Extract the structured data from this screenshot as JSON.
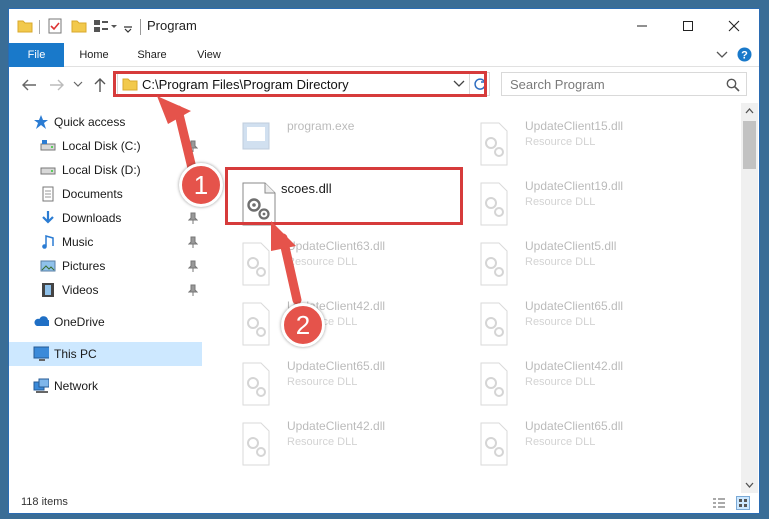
{
  "window": {
    "title": "Program"
  },
  "ribbon": {
    "tabs": [
      "File",
      "Home",
      "Share",
      "View"
    ]
  },
  "address_bar": {
    "path": "C:\\Program Files\\Program Directory"
  },
  "search": {
    "placeholder": "Search Program"
  },
  "sidebar": {
    "items": [
      {
        "label": "Quick access",
        "icon": "star-icon"
      },
      {
        "label": "Local Disk (C:)",
        "icon": "drive-icon",
        "pinned": true
      },
      {
        "label": "Local Disk (D:)",
        "icon": "drive-icon",
        "pinned": true
      },
      {
        "label": "Documents",
        "icon": "documents-icon",
        "pinned": true
      },
      {
        "label": "Downloads",
        "icon": "download-icon",
        "pinned": true
      },
      {
        "label": "Music",
        "icon": "music-icon",
        "pinned": true
      },
      {
        "label": "Pictures",
        "icon": "pictures-icon",
        "pinned": true
      },
      {
        "label": "Videos",
        "icon": "videos-icon",
        "pinned": true
      },
      {
        "label": "OneDrive",
        "icon": "cloud-icon"
      },
      {
        "label": "This PC",
        "icon": "computer-icon",
        "selected": true
      },
      {
        "label": "Network",
        "icon": "network-icon"
      }
    ]
  },
  "files": [
    {
      "name": "program.exe",
      "type": ""
    },
    {
      "name": "UpdateClient15.dll",
      "type": "Resource DLL"
    },
    {
      "name": "scoes.dll",
      "type": "",
      "highlighted": true
    },
    {
      "name": "UpdateClient19.dll",
      "type": "Resource DLL"
    },
    {
      "name": "UpdateClient63.dll",
      "type": "Resource DLL"
    },
    {
      "name": "UpdateClient5.dll",
      "type": "Resource DLL"
    },
    {
      "name": "UpdateClient42.dll",
      "type": "Resource DLL"
    },
    {
      "name": "UpdateClient65.dll",
      "type": "Resource DLL"
    },
    {
      "name": "UpdateClient65.dll",
      "type": "Resource DLL"
    },
    {
      "name": "UpdateClient42.dll",
      "type": "Resource DLL"
    },
    {
      "name": "UpdateClient42.dll",
      "type": "Resource DLL"
    },
    {
      "name": "UpdateClient65.dll",
      "type": "Resource DLL"
    }
  ],
  "status": {
    "item_count": "118 items"
  },
  "annotations": {
    "step1": "1",
    "step2": "2"
  },
  "colors": {
    "accent": "#1979ca",
    "highlight": "#d63b3b",
    "badge": "#e5534b"
  }
}
